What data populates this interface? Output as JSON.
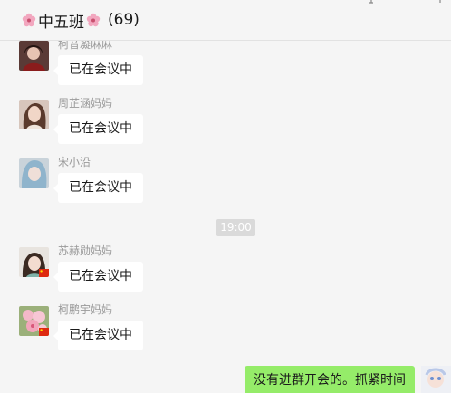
{
  "header": {
    "title": "中五班",
    "member_count": "(69)"
  },
  "messages": [
    {
      "sender": "柯音凝麻麻",
      "text": "已在会议中",
      "avatar": "photo-avatar-dark-hair"
    },
    {
      "sender": "周芷涵妈妈",
      "text": "已在会议中",
      "avatar": "photo-avatar-woman"
    },
    {
      "sender": "宋小沿",
      "text": "已在会议中",
      "avatar": "photo-avatar-blue-hair"
    },
    {
      "sender": "苏赫勋妈妈",
      "text": "已在会议中",
      "avatar": "photo-avatar-with-flag"
    },
    {
      "sender": "柯鹏宇妈妈",
      "text": "已在会议中",
      "avatar": "flower-avatar-with-flag"
    }
  ],
  "timestamp": "19:00",
  "self_message": {
    "text": "没有进群开会的。抓紧时间"
  },
  "colors": {
    "background": "#f5f5f5",
    "incoming_bubble": "#ffffff",
    "outgoing_bubble": "#95ec69",
    "sender_name": "#9a9a9a",
    "timestamp_bg": "#dadada"
  }
}
